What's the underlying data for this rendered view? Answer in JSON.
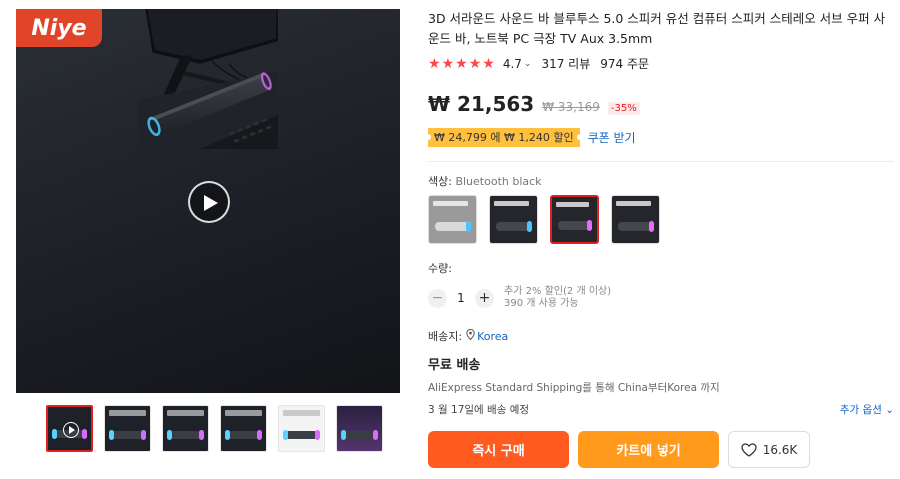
{
  "gallery": {
    "brand_logo": "Niye",
    "thumbnail_captions": [
      "",
      "3D surround Stereo sound",
      "15\" Novel design",
      "",
      "",
      ""
    ]
  },
  "product": {
    "title": "3D 서라운드 사운드 바 블루투스 5.0 스피커 유선 컴퓨터 스피커 스테레오 서브 우퍼 사운드 바, 노트북 PC 극장 TV Aux 3.5mm",
    "rating": "4.7",
    "reviews": "317 리뷰",
    "orders": "974 주문",
    "star_color": "#ff4747"
  },
  "pricing": {
    "price": "₩ 21,563",
    "original_price": "₩ 33,169",
    "discount": "-35%",
    "coupon_text": "₩ 24,799 에 ₩ 1,240 할인",
    "coupon_link": "쿠폰 받기",
    "accent_color": "#e02020"
  },
  "options": {
    "color_label": "색상:",
    "color_value": "Bluetooth black",
    "swatches": [
      "gray",
      "black",
      "black-selected",
      "black"
    ],
    "selected_index": 2
  },
  "quantity": {
    "label": "수량:",
    "value": "1",
    "minus": "−",
    "plus": "+",
    "note_line1": "추가 2% 할인(2 개 이상)",
    "note_line2": "390 개 사용 가능"
  },
  "shipping": {
    "label": "배송지:",
    "country": "Korea",
    "free_shipping": "무료 배송",
    "method": "AliExpress Standard Shipping를 통해 China부터Korea 까지",
    "delivery": "3 월 17일에 배송 예정",
    "more_options": "추가 옵션 ⌄"
  },
  "actions": {
    "buy_now": "즉시 구매",
    "add_to_cart": "카트에 넣기",
    "wishlist_count": "16.6K",
    "buy_color": "#ff5a1f",
    "cart_color": "#ff9a1c"
  }
}
